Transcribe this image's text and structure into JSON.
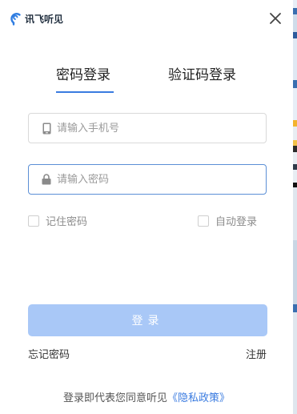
{
  "app": {
    "logo_text": "讯飞听见",
    "brand_color": "#3a7be0"
  },
  "tabs": [
    {
      "label": "密码登录",
      "active": true
    },
    {
      "label": "验证码登录",
      "active": false
    }
  ],
  "phone_field": {
    "placeholder": "请输入手机号",
    "value": "",
    "icon": "phone-icon"
  },
  "password_field": {
    "placeholder": "请输入密码",
    "value": "",
    "icon": "lock-icon"
  },
  "options": {
    "remember_label": "记住密码",
    "remember_checked": false,
    "auto_login_label": "自动登录",
    "auto_login_checked": false
  },
  "login_button": {
    "label": "登录",
    "color": "#a9c8f7"
  },
  "links": {
    "forgot": "忘记密码",
    "register": "注册"
  },
  "footer": {
    "prefix": "登录即代表您同意听见",
    "policy": "《隐私政策》"
  }
}
